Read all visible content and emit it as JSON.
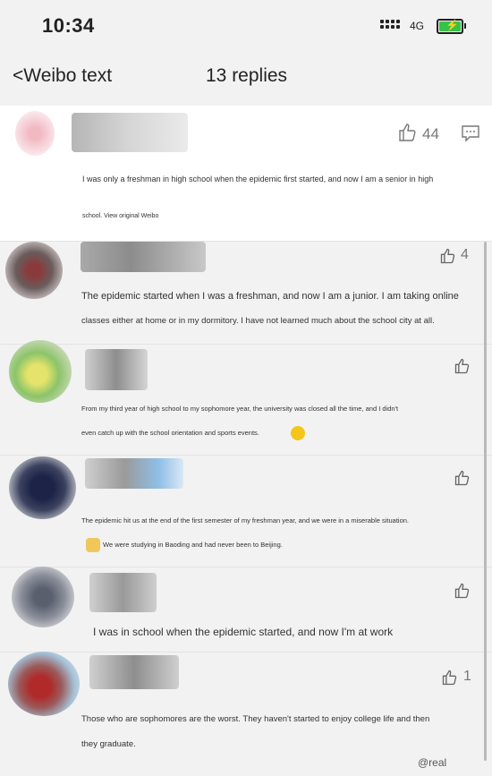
{
  "status_bar": {
    "time": "10:34",
    "network": "4G"
  },
  "nav": {
    "back_label": "<Weibo text",
    "title": "13 replies"
  },
  "original_post": {
    "like_count": "44",
    "text_line1": "I was only a freshman in high school when the epidemic first started, and now I am a senior in high",
    "text_line2": "school. View original Weibo"
  },
  "replies": [
    {
      "like_count": "4",
      "text_line1": "The epidemic started when I was a freshman, and now I am a junior. I am taking online",
      "text_line2": "classes either at home or in my dormitory. I have not learned much about the school city at all."
    },
    {
      "like_count": "",
      "text_line1": "From my third year of high school to my sophomore year, the university was closed all the time, and I didn't",
      "text_line2": "even catch up with the school orientation and sports events."
    },
    {
      "like_count": "",
      "text_line1": "The epidemic hit us at the end of the first semester of my freshman year, and we were in a miserable situation.",
      "text_line2": "We were studying in Baoding and had never been to Beijing."
    },
    {
      "like_count": "",
      "text_line1": "I was in school when the epidemic started, and now I'm at work",
      "text_line2": ""
    },
    {
      "like_count": "1",
      "text_line1": "Those who are sophomores are the worst. They haven't started to enjoy college life and then",
      "text_line2": "they graduate."
    }
  ],
  "watermark": "@real"
}
